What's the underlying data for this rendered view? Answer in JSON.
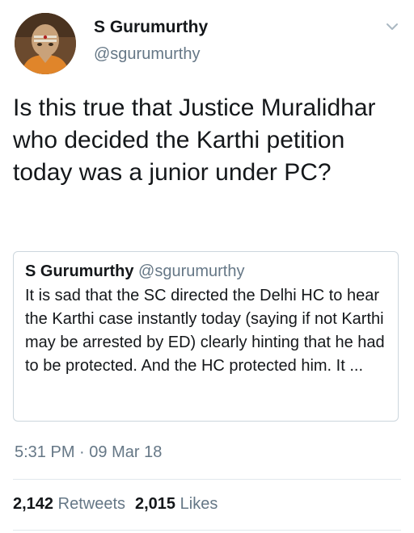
{
  "author": {
    "display_name": "S Gurumurthy",
    "handle": "@sgurumurthy",
    "avatar": "avatar-photo"
  },
  "tweet": {
    "text": "Is this true that Justice Muralidhar who decided the Karthi petition today was a junior under PC?"
  },
  "quoted_tweet": {
    "display_name": "S Gurumurthy",
    "handle": "@sgurumurthy",
    "text": "It is sad that the SC directed the Delhi HC to hear the Karthi case instantly today (saying if not Karthi may be arrested by ED) clearly hinting that he had to be protected. And the HC protected him. It ..."
  },
  "meta": {
    "time": "5:31 PM",
    "separator": "·",
    "date": "09 Mar 18"
  },
  "stats": {
    "retweets_count": "2,142",
    "retweets_label": "Retweets",
    "likes_count": "2,015",
    "likes_label": "Likes"
  },
  "icons": {
    "menu": "chevron-down-icon"
  },
  "colors": {
    "text": "#14171a",
    "muted": "#657786",
    "border": "#ccd6dd",
    "divider": "#e1e8ed"
  }
}
